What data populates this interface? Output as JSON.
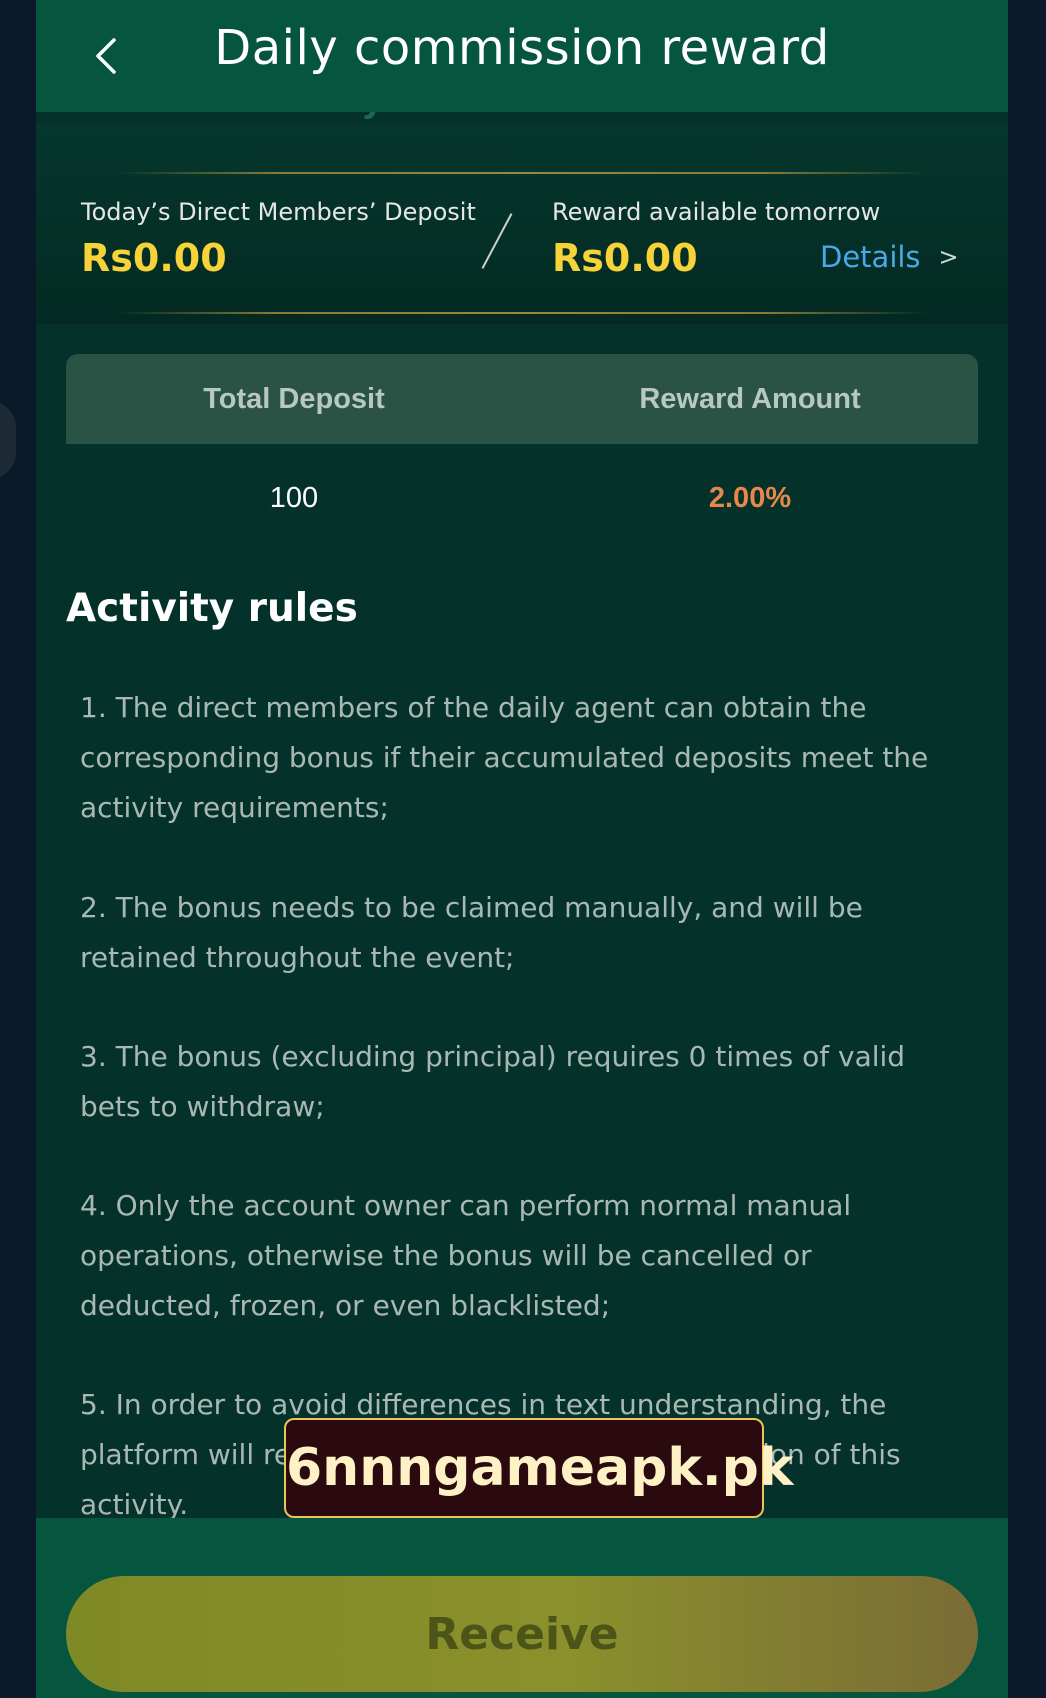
{
  "header": {
    "title": "Daily commission reward",
    "back_icon": "chevron-left-icon"
  },
  "banner_peek": "= Daily commission reward =",
  "summary": {
    "deposit_label": "Today’s Direct Members’ Deposit",
    "deposit_value": "Rs0.00",
    "reward_label": "Reward available tomorrow",
    "reward_value": "Rs0.00",
    "details_label": "Details",
    "details_chevron": ">"
  },
  "table": {
    "headers": [
      "Total Deposit",
      "Reward Amount"
    ],
    "rows": [
      {
        "deposit": "100",
        "reward": "2.00%"
      }
    ]
  },
  "rules": {
    "title": "Activity rules",
    "items": [
      "1. The direct members of the daily agent can obtain the corresponding bonus if their accumulated deposits meet the activity requirements;",
      "2. The bonus needs to be claimed manually, and will be retained throughout the event;",
      "3. The bonus (excluding principal) requires 0 times of valid bets to withdraw;",
      "4. Only the account owner can perform normal manual operations, otherwise the bonus will be cancelled or deducted, frozen, or even blacklisted;",
      "5. In order to avoid differences in text understanding, the platform will reserve the right of final interpretation of this activity."
    ]
  },
  "watermark": "6nnngameapk.pk",
  "footer": {
    "receive_label": "Receive"
  },
  "colors": {
    "header_bg": "#06553f",
    "page_bg": "#04322a",
    "gold_value": "#f6d338",
    "link_blue": "#4aa8e6",
    "reward_orange": "#e8874a",
    "button_olive": "#8a902c"
  }
}
